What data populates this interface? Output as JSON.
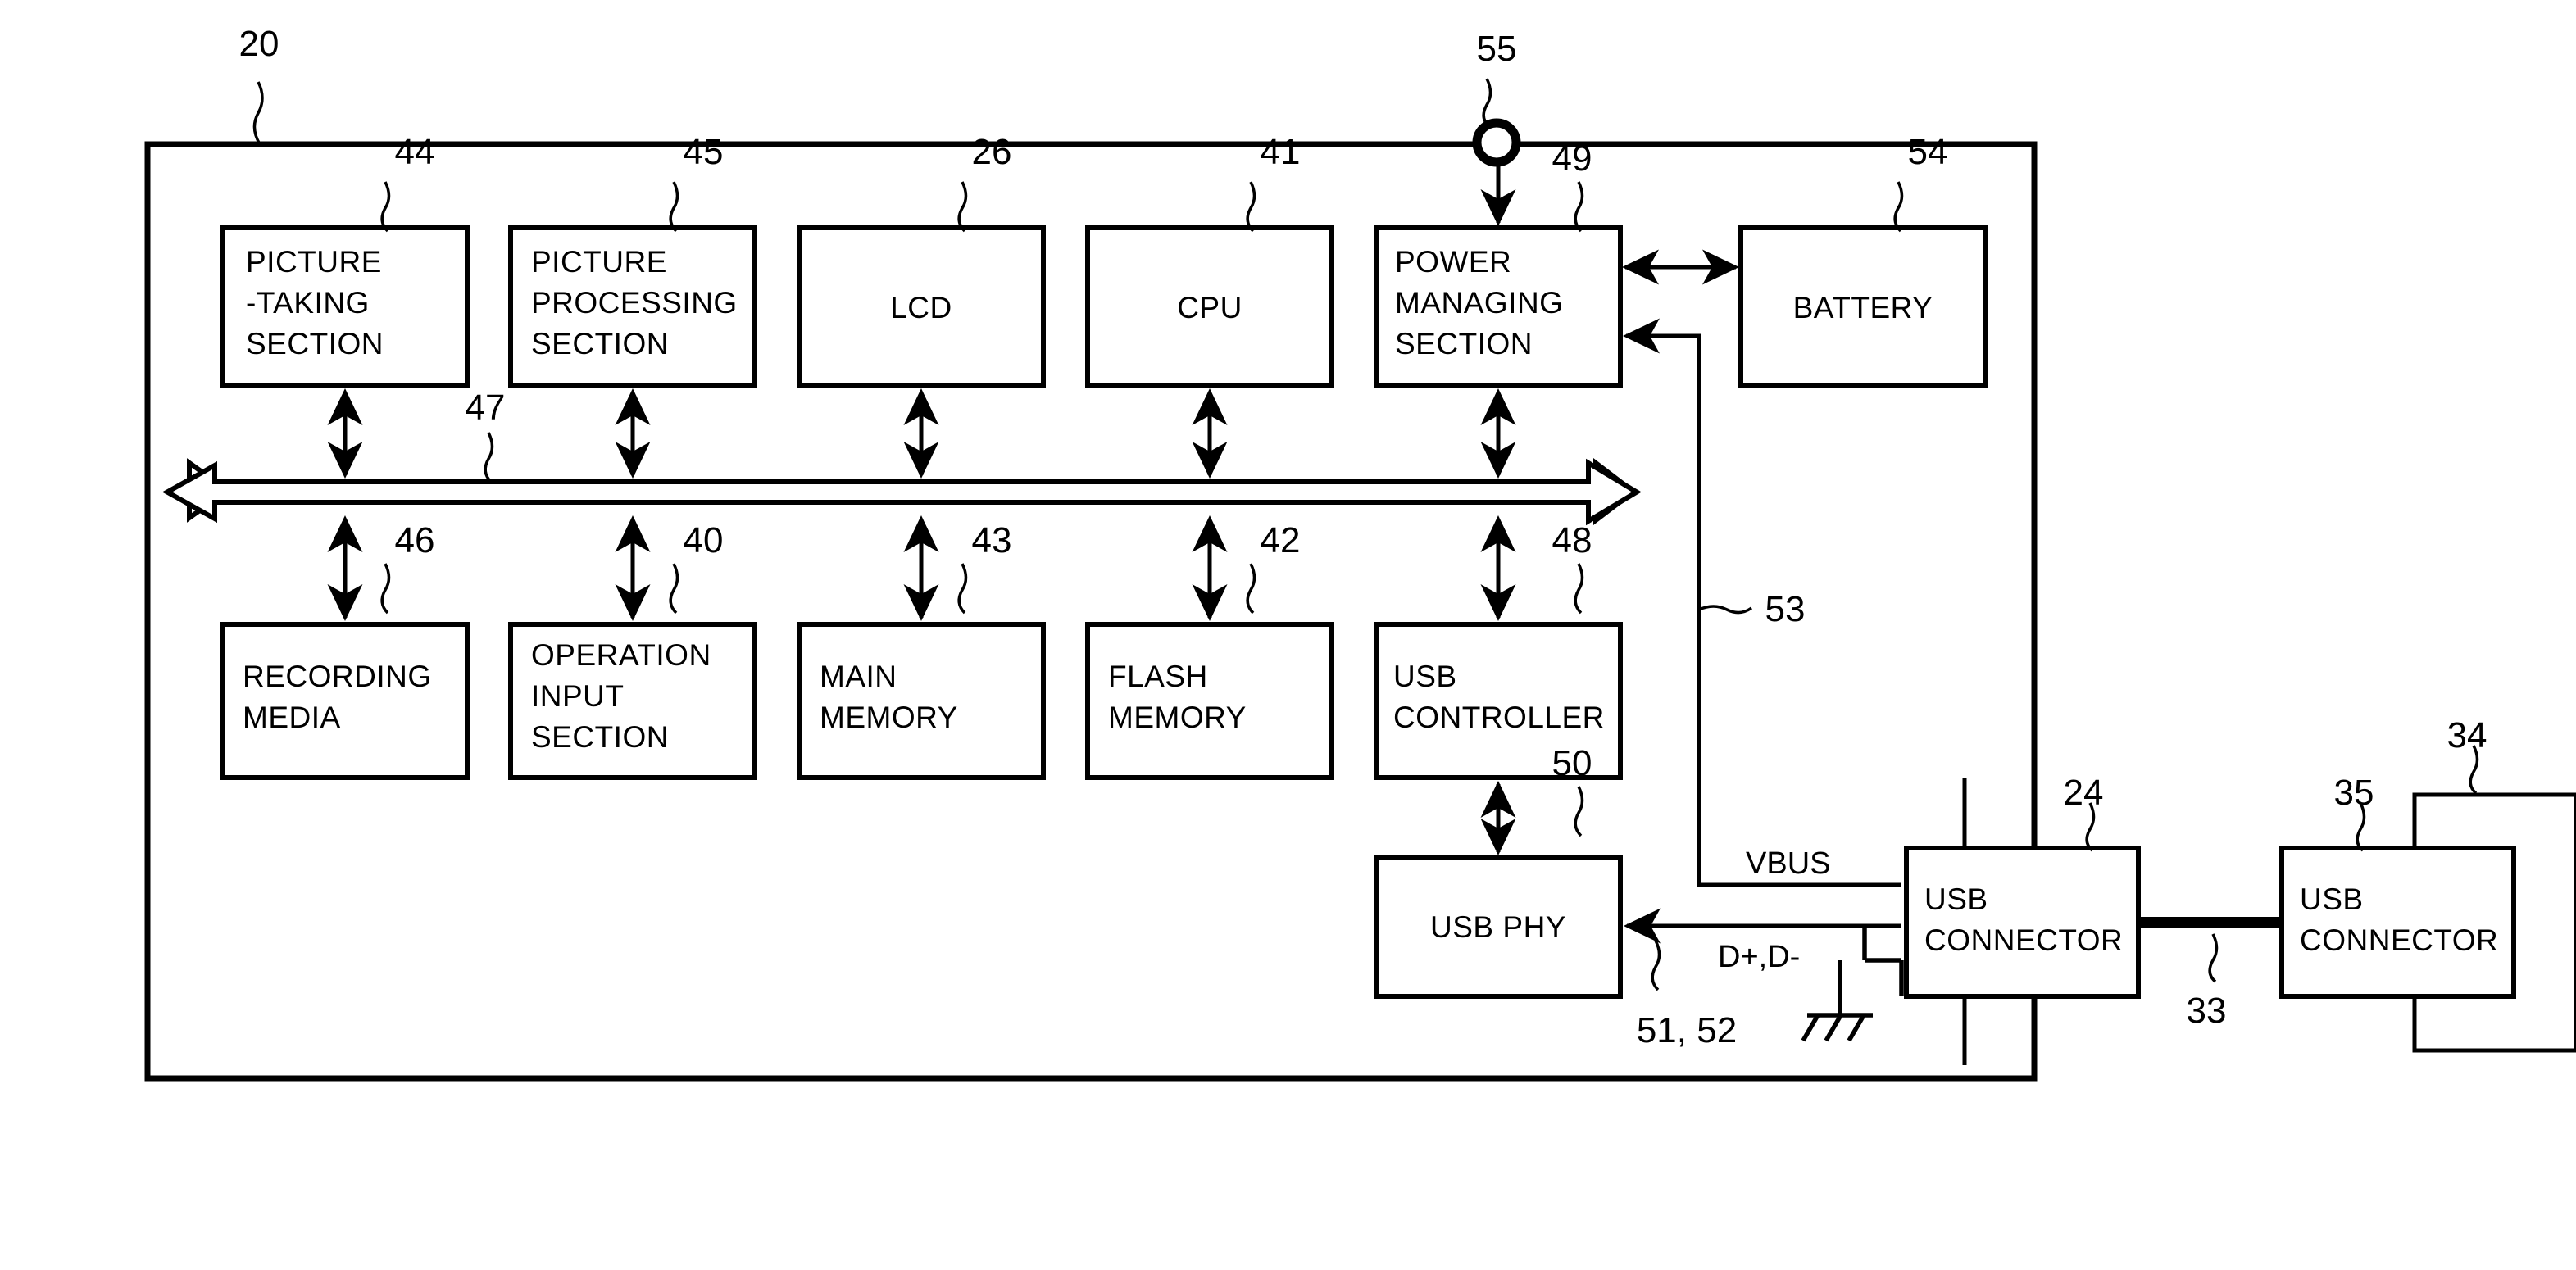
{
  "figure": {
    "type": "patent-block-diagram",
    "device_reference": "20"
  },
  "blocks": [
    {
      "id": "picture-taking-section",
      "ref": "44",
      "lines": [
        "PICTURE",
        "-TAKING",
        "SECTION"
      ],
      "align": "left"
    },
    {
      "id": "picture-processing-section",
      "ref": "45",
      "lines": [
        "PICTURE",
        "PROCESSING",
        "SECTION"
      ],
      "align": "left"
    },
    {
      "id": "lcd",
      "ref": "26",
      "lines": [
        "LCD"
      ],
      "align": "center"
    },
    {
      "id": "cpu",
      "ref": "41",
      "lines": [
        "CPU"
      ],
      "align": "center"
    },
    {
      "id": "power-managing-section",
      "ref": "49",
      "lines": [
        "POWER",
        "MANAGING",
        "SECTION"
      ],
      "align": "left"
    },
    {
      "id": "battery",
      "ref": "54",
      "lines": [
        "BATTERY"
      ],
      "align": "center"
    },
    {
      "id": "recording-media",
      "ref": "46",
      "lines": [
        "RECORDING",
        "MEDIA"
      ],
      "align": "left"
    },
    {
      "id": "operation-input-section",
      "ref": "40",
      "lines": [
        "OPERATION",
        "INPUT",
        "SECTION"
      ],
      "align": "left"
    },
    {
      "id": "main-memory",
      "ref": "43",
      "lines": [
        "MAIN",
        "MEMORY"
      ],
      "align": "left"
    },
    {
      "id": "flash-memory",
      "ref": "42",
      "lines": [
        "FLASH",
        "MEMORY"
      ],
      "align": "left"
    },
    {
      "id": "usb-controller",
      "ref": "48",
      "lines": [
        "USB",
        "CONTROLLER"
      ],
      "align": "left"
    },
    {
      "id": "usb-phy",
      "ref": "50",
      "lines": [
        "USB PHY"
      ],
      "align": "center"
    },
    {
      "id": "usb-connector-device",
      "ref": "24",
      "lines": [
        "USB",
        "CONNECTOR"
      ],
      "align": "left"
    },
    {
      "id": "usb-connector-host",
      "ref": "35",
      "lines": [
        "USB",
        "CONNECTOR"
      ],
      "align": "left"
    },
    {
      "id": "external-host",
      "ref": "34",
      "lines": [],
      "align": "center"
    }
  ],
  "references": {
    "device": "20",
    "picture_taking": "44",
    "picture_processing": "45",
    "lcd": "26",
    "cpu": "41",
    "power_managing": "49",
    "battery": "54",
    "switch": "55",
    "bus": "47",
    "recording_media": "46",
    "operation_input": "40",
    "main_memory": "43",
    "flash_memory": "42",
    "usb_controller": "48",
    "usb_phy": "50",
    "vbus_line": "53",
    "data_lines": "51, 52",
    "usb_connector_device": "24",
    "usb_cable": "33",
    "usb_connector_host": "35",
    "external_host": "34"
  },
  "signals": {
    "vbus": "VBUS",
    "data": "D+,D-"
  },
  "colors": {
    "ink": "#000000",
    "paper": "#ffffff"
  }
}
